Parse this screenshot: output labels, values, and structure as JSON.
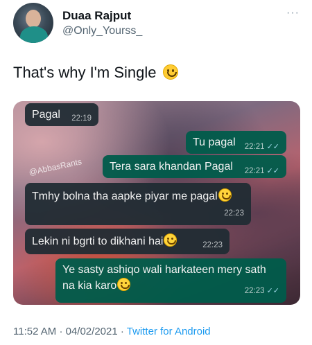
{
  "user": {
    "display_name": "Duaa Rajput",
    "handle": "@Only_Yourss_",
    "avatar_icon": "profile-photo"
  },
  "tweet": {
    "text": "That's why I'm Single",
    "emoji_icon": "slightly-smiling-face-emoji"
  },
  "chat": {
    "watermark": "@AbbasRants",
    "messages": [
      {
        "direction": "in",
        "text": "Pagal",
        "time": "22:19",
        "read": false
      },
      {
        "direction": "out",
        "text": "Tu pagal",
        "time": "22:21",
        "read": true
      },
      {
        "direction": "out",
        "text": "Tera sara khandan Pagal",
        "time": "22:21",
        "read": true
      },
      {
        "direction": "in",
        "text": "Tmhy bolna tha aapke piyar me pagal",
        "time": "22:23",
        "read": false
      },
      {
        "direction": "in",
        "text": "Lekin ni bgrti to dikhani hai",
        "time": "22:23",
        "read": false
      },
      {
        "direction": "out",
        "text_line1": "Ye sasty ashiqo wali harkateen mery sath",
        "text_line2": "na kia karo",
        "time": "22:23",
        "read": true
      }
    ],
    "read_tick": "✓✓"
  },
  "footer": {
    "time": "11:52 AM",
    "separator": "·",
    "date": "04/02/2021",
    "source": "Twitter for Android"
  },
  "colors": {
    "incoming_bubble": "#202c33",
    "outgoing_bubble": "#005c4b",
    "link": "#1d9bf0",
    "secondary_text": "#536471"
  }
}
